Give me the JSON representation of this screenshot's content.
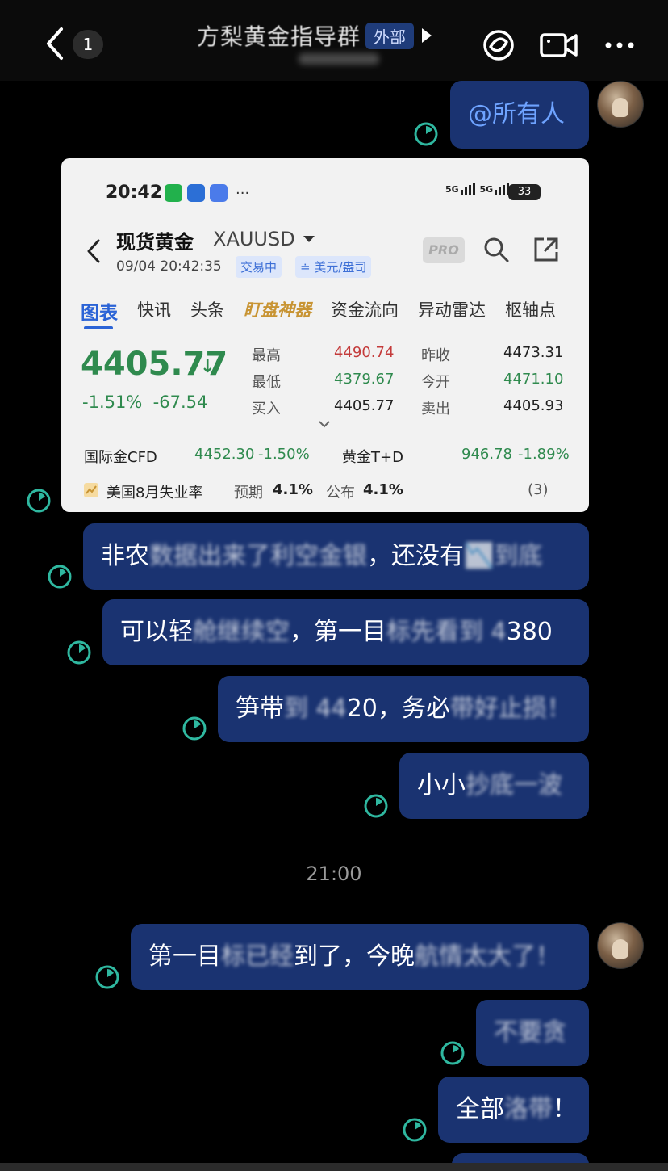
{
  "header": {
    "back_badge": "1",
    "title": "方梨黄金指导群",
    "external_tag": "外部"
  },
  "messages": {
    "m1": "@所有人",
    "m2_a": "非农",
    "m2_b": "数据出来了利空金银",
    "m2_c": "，还没有",
    "m2_d": "📉",
    "m2_e": "到底",
    "m3_a": "可以轻",
    "m3_b": "舱继续空",
    "m3_c": "，第一目",
    "m3_d": "标先看到 4",
    "m3_e": "380",
    "m4_a": "笋带",
    "m4_b": "到 44",
    "m4_c": "20",
    "m4_d": "，务必",
    "m4_e": "带好止损！",
    "m5_a": "小小",
    "m5_b": "抄底一波",
    "time_sep": "21:00",
    "m6_a": "第一目",
    "m6_b": "标已经",
    "m6_c": "到了，今晚",
    "m6_d": "航情太大了！",
    "m7": "不要贪",
    "m8_a": "全部",
    "m8_b": "洛带",
    "m8_c": "！"
  },
  "card": {
    "status_time": "20:42",
    "status_dots": "···",
    "signal_label": "5G",
    "battery": "33",
    "name": "现货黄金",
    "symbol": "XAUUSD",
    "datetime": "09/04 20:42:35",
    "tag_trading": "交易中",
    "tag_currency": "≐ 美元/盎司",
    "pro": "PRO",
    "tabs": {
      "chart": "图表",
      "flash": "快讯",
      "headlines": "头条",
      "watch": "盯盘神器",
      "flow": "资金流向",
      "radar": "异动雷达",
      "pivot": "枢轴点"
    },
    "price": "4405.77",
    "price_arrow": "↓",
    "change_pct": "-1.51%",
    "change_abs": "-67.54",
    "quote": {
      "high_label": "最高",
      "high": "4490.74",
      "low_label": "最低",
      "low": "4379.67",
      "bid_label": "买入",
      "bid": "4405.77",
      "prev_label": "昨收",
      "prev": "4473.31",
      "open_label": "今开",
      "open": "4471.10",
      "ask_label": "卖出",
      "ask": "4405.93"
    },
    "related": {
      "cfd_label": "国际金CFD",
      "cfd_price": "4452.30",
      "cfd_chg": "-1.50%",
      "td_label": "黄金T+D",
      "td_price": "946.78",
      "td_chg": "-1.89%"
    },
    "event": {
      "title": "美国8月失业率",
      "expected_label": "预期",
      "expected": "4.1%",
      "actual_label": "公布",
      "actual": "4.1%",
      "count": "(3)"
    }
  },
  "colors": {
    "bubble": "#1a3371",
    "mention": "#6ea3ff",
    "up_red": "#c43b3b",
    "down_green": "#2f8a4e",
    "status_ring": "#2fb8a0"
  }
}
